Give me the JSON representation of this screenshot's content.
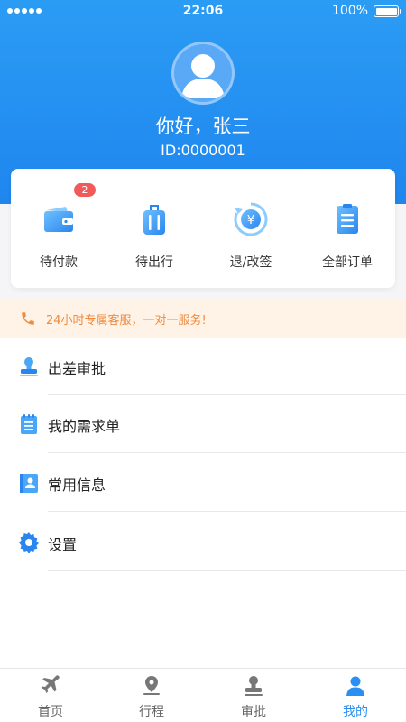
{
  "status_bar": {
    "time": "22:06",
    "battery": "100%"
  },
  "profile": {
    "greeting": "你好，张三",
    "id": "ID:0000001"
  },
  "orders": {
    "items": [
      {
        "label": "待付款",
        "icon": "wallet-icon",
        "badge": "2"
      },
      {
        "label": "待出行",
        "icon": "luggage-icon"
      },
      {
        "label": "退/改签",
        "icon": "refund-yuan-icon"
      },
      {
        "label": "全部订单",
        "icon": "clipboard-list-icon"
      }
    ]
  },
  "notice": {
    "text": "24小时专属客服，一对一服务!",
    "icon": "phone-icon"
  },
  "menu": {
    "items": [
      {
        "label": "出差审批",
        "icon": "stamp-icon"
      },
      {
        "label": "我的需求单",
        "icon": "notepad-icon"
      },
      {
        "label": "常用信息",
        "icon": "contact-card-icon"
      },
      {
        "label": "设置",
        "icon": "gear-icon"
      }
    ]
  },
  "tabbar": {
    "items": [
      {
        "label": "首页",
        "icon": "airplane-icon",
        "active": false
      },
      {
        "label": "行程",
        "icon": "route-pin-icon",
        "active": false
      },
      {
        "label": "审批",
        "icon": "stamp-icon",
        "active": false
      },
      {
        "label": "我的",
        "icon": "person-icon",
        "active": true
      }
    ]
  },
  "colors": {
    "brand": "#2b8ff2",
    "badge": "#f15a5a",
    "notice_text": "#f08a3c",
    "notice_bg": "#fff3e8"
  }
}
